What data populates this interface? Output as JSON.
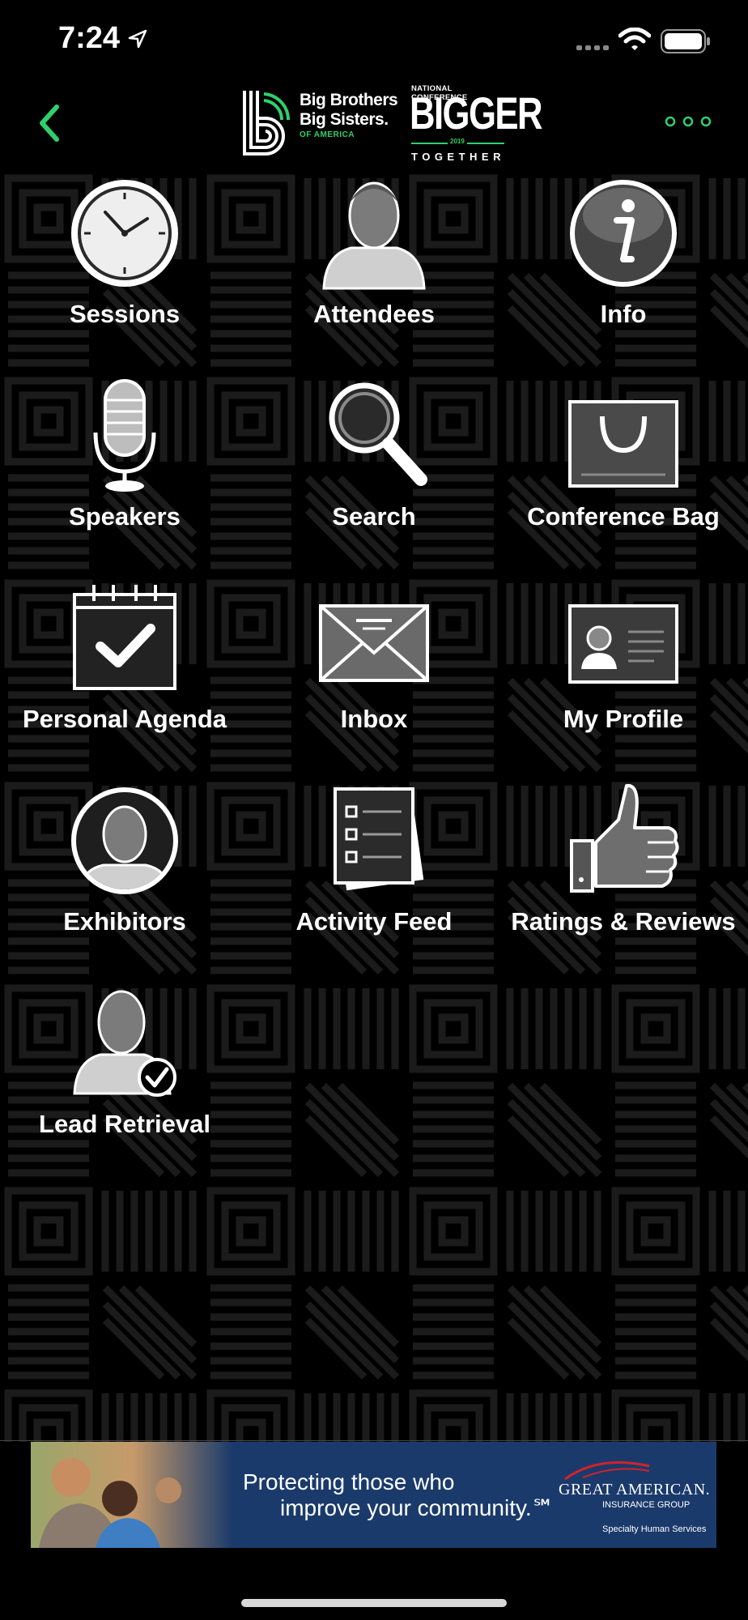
{
  "status": {
    "time": "7:24",
    "icons": [
      "location-arrow-icon",
      "signal-icon",
      "wifi-icon",
      "battery-icon"
    ]
  },
  "nav": {
    "back_icon": "chevron-left-icon",
    "more_icon": "ellipsis-icon",
    "accent": "#2fd06b",
    "brand_line1": "Big Brothers",
    "brand_line2": "Big Sisters.",
    "brand_line3": "OF AMERICA",
    "conf_top": "NATIONAL CONFERENCE",
    "conf_big": "BIGGER",
    "conf_year": "2019",
    "conf_bottom": "TOGETHER"
  },
  "menu": [
    {
      "label": "Sessions",
      "icon": "clock-icon"
    },
    {
      "label": "Attendees",
      "icon": "person-icon"
    },
    {
      "label": "Info",
      "icon": "info-icon"
    },
    {
      "label": "Speakers",
      "icon": "microphone-icon"
    },
    {
      "label": "Search",
      "icon": "magnifier-icon"
    },
    {
      "label": "Conference Bag",
      "icon": "bag-icon"
    },
    {
      "label": "Personal Agenda",
      "icon": "calendar-check-icon"
    },
    {
      "label": "Inbox",
      "icon": "envelope-icon"
    },
    {
      "label": "My Profile",
      "icon": "id-card-icon"
    },
    {
      "label": "Exhibitors",
      "icon": "person-circle-icon"
    },
    {
      "label": "Activity Feed",
      "icon": "checklist-icon"
    },
    {
      "label": "Ratings & Reviews",
      "icon": "thumbs-up-icon"
    },
    {
      "label": "Lead Retrieval",
      "icon": "person-check-icon"
    }
  ],
  "banner": {
    "line1": "Protecting those who",
    "line2": "improve your community.℠",
    "sponsor_name": "GREAT AMERICAN.",
    "sponsor_sub1": "INSURANCE GROUP",
    "sponsor_sub2": "",
    "sponsor_spec": "Specialty Human Services",
    "bg": "#1a3a6b"
  }
}
